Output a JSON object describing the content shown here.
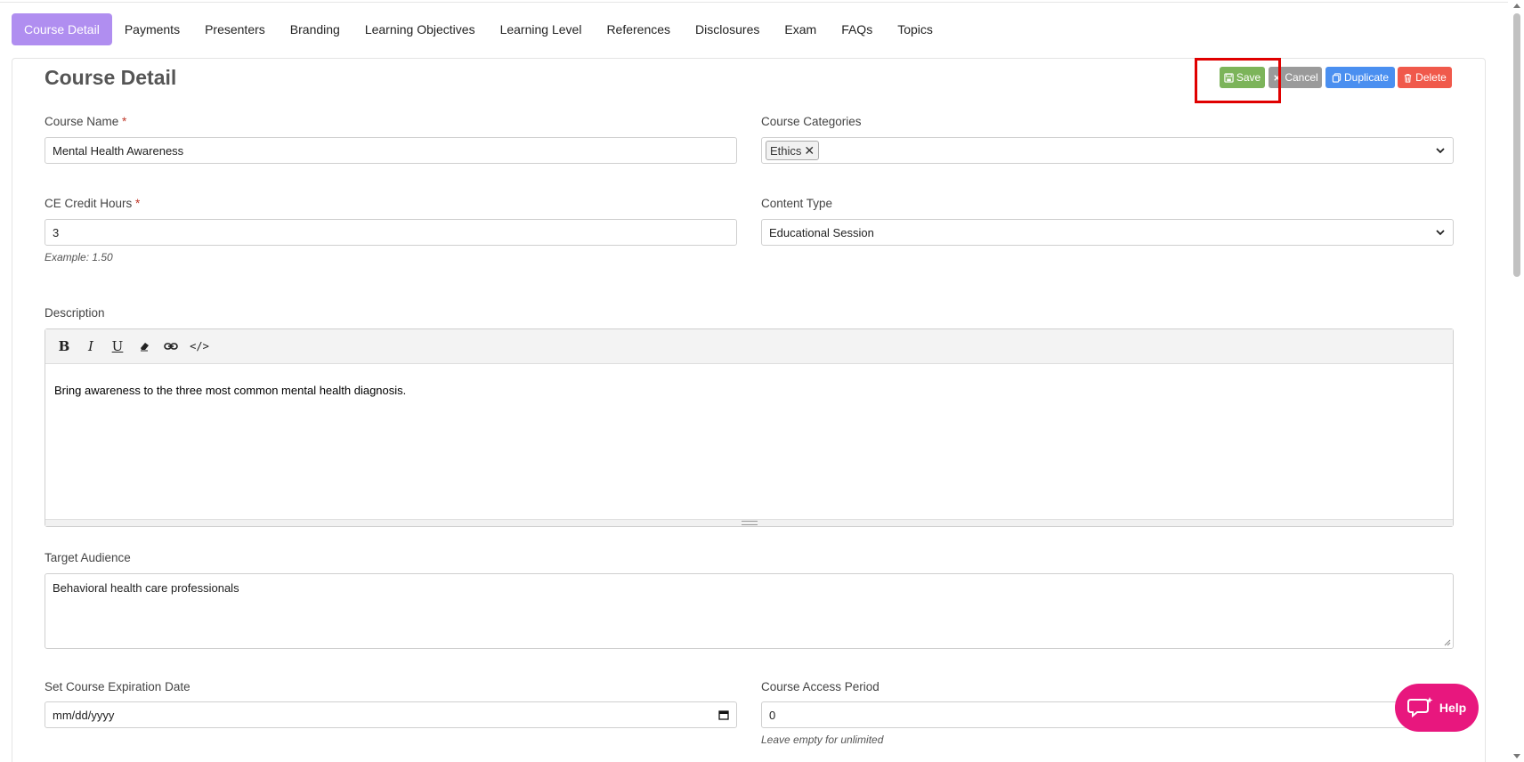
{
  "tabs": [
    {
      "label": "Course Detail",
      "active": true
    },
    {
      "label": "Payments"
    },
    {
      "label": "Presenters"
    },
    {
      "label": "Branding"
    },
    {
      "label": "Learning Objectives"
    },
    {
      "label": "Learning Level"
    },
    {
      "label": "References"
    },
    {
      "label": "Disclosures"
    },
    {
      "label": "Exam"
    },
    {
      "label": "FAQs"
    },
    {
      "label": "Topics"
    }
  ],
  "page_title": "Course Detail",
  "actions": {
    "save": "Save",
    "cancel": "Cancel",
    "duplicate": "Duplicate",
    "delete": "Delete"
  },
  "form": {
    "course_name": {
      "label": "Course Name",
      "required_mark": "*",
      "value": "Mental Health Awareness"
    },
    "course_categories": {
      "label": "Course Categories",
      "selected": [
        "Ethics"
      ],
      "remove_glyph": "✕"
    },
    "ce_credit_hours": {
      "label": "CE Credit Hours",
      "required_mark": "*",
      "value": "3",
      "hint": "Example: 1.50"
    },
    "content_type": {
      "label": "Content Type",
      "value": "Educational Session"
    },
    "description": {
      "label": "Description",
      "toolbar": {
        "bold": "B",
        "italic": "I",
        "underline": "U",
        "code": "</>"
      },
      "value": "Bring awareness to the three most common mental health diagnosis."
    },
    "target_audience": {
      "label": "Target Audience",
      "value": "Behavioral health care professionals"
    },
    "expiration_date": {
      "label": "Set Course Expiration Date",
      "placeholder": "mm/dd/yyyy"
    },
    "access_period": {
      "label": "Course Access Period",
      "value": "0",
      "hint": "Leave empty for unlimited"
    }
  },
  "help_button": {
    "label": "Help"
  },
  "colors": {
    "active_tab": "#b08ef0",
    "save": "#7cb45a",
    "cancel": "#9a9a9a",
    "duplicate": "#4a8ff0",
    "delete": "#f0594b",
    "help": "#e8177e",
    "highlight": "#e00000"
  }
}
